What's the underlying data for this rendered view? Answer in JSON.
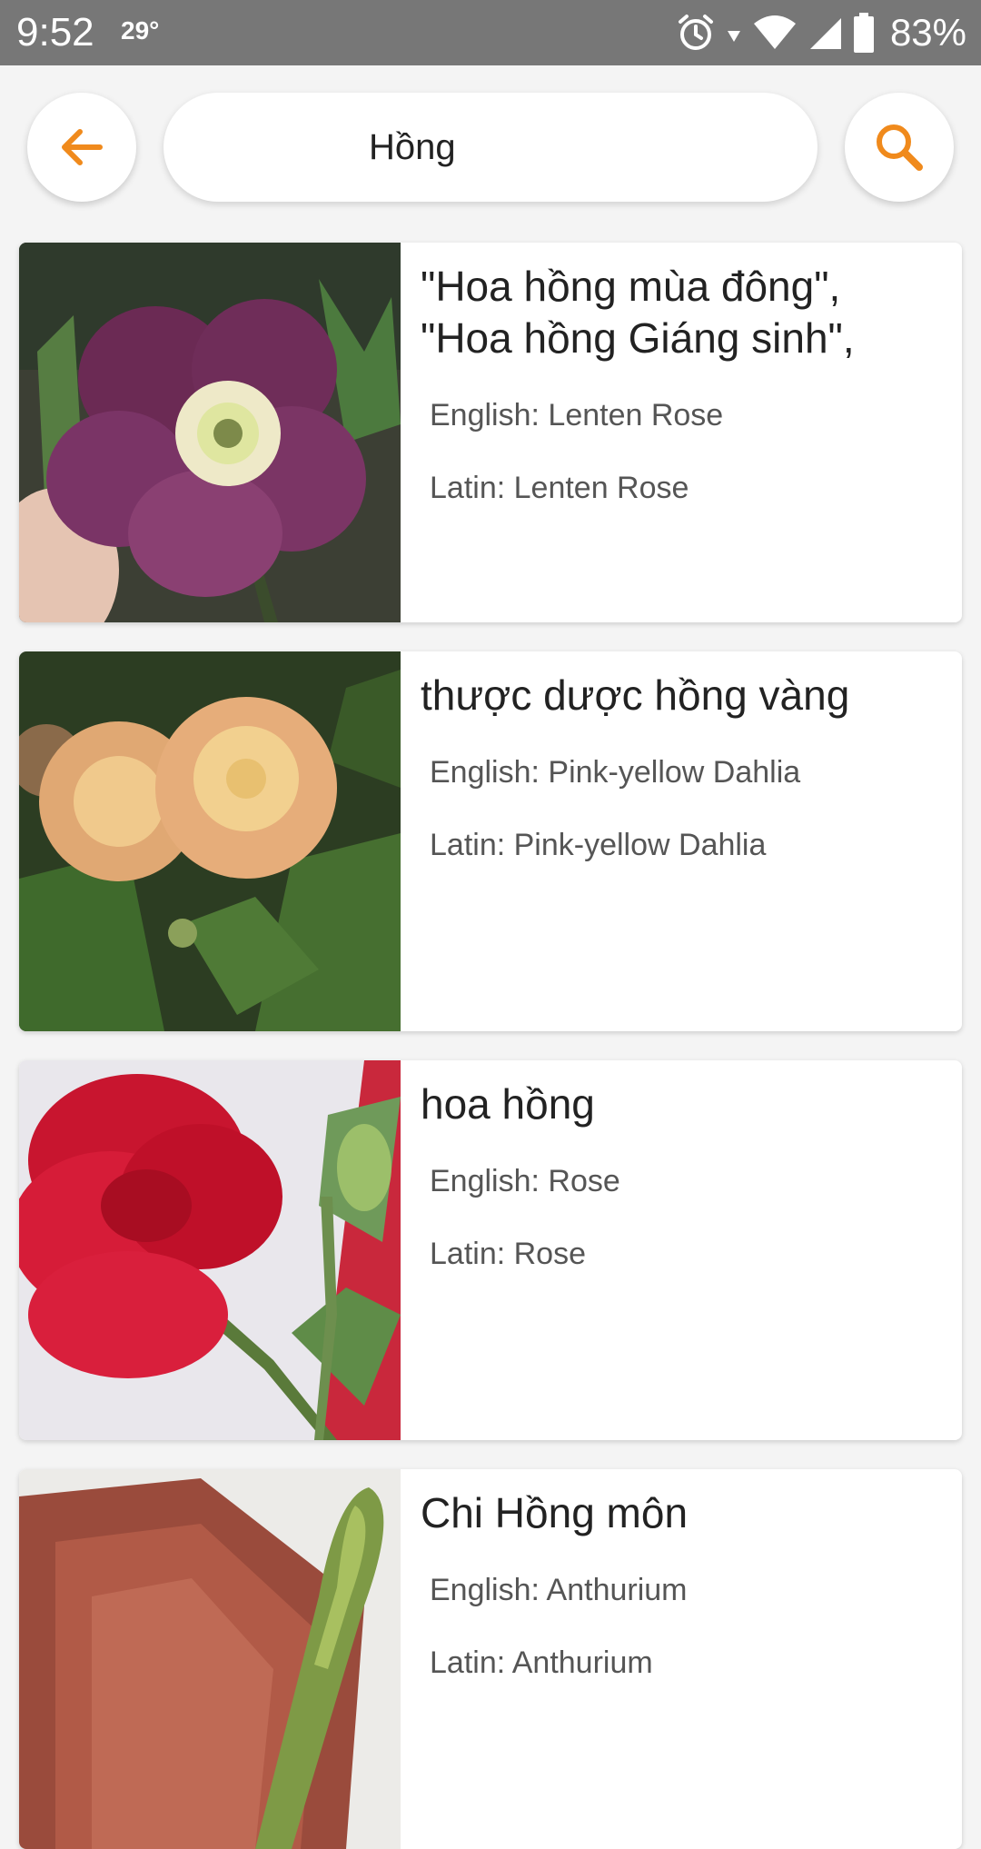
{
  "status_bar": {
    "time": "9:52",
    "temperature": "29°",
    "battery": "83%"
  },
  "search": {
    "query": "Hồng"
  },
  "results": [
    {
      "title": "\"Hoa hồng mùa đông\", \"Hoa hồng Giáng sinh\",",
      "english": "English: Lenten Rose",
      "latin": "Latin: Lenten Rose"
    },
    {
      "title": "thược dược hồng vàng",
      "english": "English: Pink-yellow Dahlia",
      "latin": "Latin: Pink-yellow Dahlia"
    },
    {
      "title": "hoa hồng",
      "english": "English: Rose",
      "latin": "Latin: Rose"
    },
    {
      "title": "Chi Hồng môn",
      "english": "English: Anthurium",
      "latin": "Latin: Anthurium"
    }
  ],
  "colors": {
    "accent": "#F08A1C",
    "status_bar": "#777777"
  },
  "icons": [
    "back-arrow-icon",
    "search-icon",
    "alarm-icon",
    "wifi-icon",
    "signal-icon",
    "battery-icon"
  ]
}
